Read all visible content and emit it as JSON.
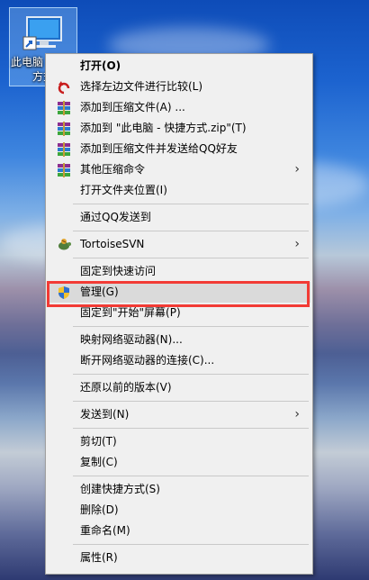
{
  "desktop": {
    "icon_label": "此电脑 - 快捷方式"
  },
  "menu": {
    "groups": [
      [
        {
          "id": "open",
          "label": "打开(O)",
          "icon": "none",
          "bold": true
        },
        {
          "id": "compare",
          "label": "选择左边文件进行比较(L)",
          "icon": "compare-icon"
        },
        {
          "id": "add-archive",
          "label": "添加到压缩文件(A) ...",
          "icon": "winrar-icon"
        },
        {
          "id": "add-zip",
          "label": "添加到 \"此电脑 - 快捷方式.zip\"(T)",
          "icon": "winrar-icon"
        },
        {
          "id": "add-send-qq",
          "label": "添加到压缩文件并发送给QQ好友",
          "icon": "winrar-icon"
        },
        {
          "id": "other-compress",
          "label": "其他压缩命令",
          "icon": "winrar-icon",
          "submenu": true
        },
        {
          "id": "open-location",
          "label": "打开文件夹位置(I)",
          "icon": "none"
        }
      ],
      [
        {
          "id": "send-qq",
          "label": "通过QQ发送到",
          "icon": "none"
        }
      ],
      [
        {
          "id": "tortoisesvn",
          "label": "TortoiseSVN",
          "icon": "tortoise-icon",
          "submenu": true
        }
      ],
      [
        {
          "id": "pin-quick",
          "label": "固定到快速访问",
          "icon": "none"
        },
        {
          "id": "manage",
          "label": "管理(G)",
          "icon": "shield-icon",
          "highlight": true
        },
        {
          "id": "pin-start",
          "label": "固定到\"开始\"屏幕(P)",
          "icon": "none"
        }
      ],
      [
        {
          "id": "map-drive",
          "label": "映射网络驱动器(N)...",
          "icon": "none"
        },
        {
          "id": "disconnect-drive",
          "label": "断开网络驱动器的连接(C)...",
          "icon": "none"
        }
      ],
      [
        {
          "id": "restore",
          "label": "还原以前的版本(V)",
          "icon": "none"
        }
      ],
      [
        {
          "id": "send-to",
          "label": "发送到(N)",
          "icon": "none",
          "submenu": true
        }
      ],
      [
        {
          "id": "cut",
          "label": "剪切(T)",
          "icon": "none"
        },
        {
          "id": "copy",
          "label": "复制(C)",
          "icon": "none"
        }
      ],
      [
        {
          "id": "create-shortcut",
          "label": "创建快捷方式(S)",
          "icon": "none"
        },
        {
          "id": "delete",
          "label": "删除(D)",
          "icon": "none"
        },
        {
          "id": "rename",
          "label": "重命名(M)",
          "icon": "none"
        }
      ],
      [
        {
          "id": "properties",
          "label": "属性(R)",
          "icon": "none"
        }
      ]
    ]
  },
  "colors": {
    "menu_bg": "#f0f0f0",
    "highlight_bg": "#dadada",
    "annotation_red": "#f23b35"
  }
}
